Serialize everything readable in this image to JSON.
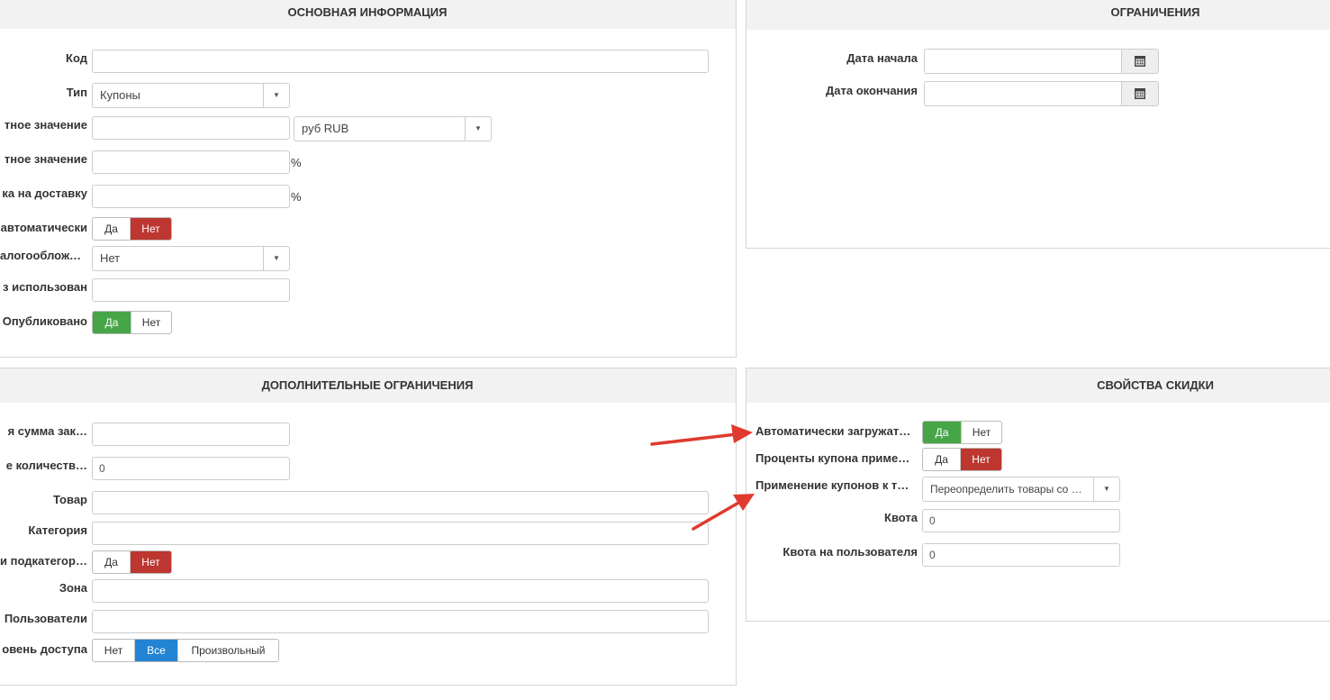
{
  "basic": {
    "title": "ОСНОВНАЯ ИНФОРМАЦИЯ",
    "code_label": "Код",
    "type_label": "Тип",
    "type_value": "Купоны",
    "fixed_label": "тное значение",
    "currency_value": "руб RUB",
    "percent_label": "тное значение",
    "shipping_label": "ка на доставку",
    "percent_sign": "%",
    "auto_label": "автоматически",
    "tax_label": "алогообложе…",
    "tax_value": "Нет",
    "uses_label": "з использован",
    "published_label": "Опубликовано",
    "yes": "Да",
    "no": "Нет"
  },
  "restrictions": {
    "title": "ОГРАНИЧЕНИЯ",
    "start_label": "Дата начала",
    "end_label": "Дата окончания"
  },
  "extra": {
    "title": "ДОПОЛНИТЕЛЬНЫЕ ОГРАНИЧЕНИЯ",
    "min_sum_label": "я сумма зак…",
    "min_qty_label": "е количеств…",
    "min_qty_value": "0",
    "product_label": "Товар",
    "category_label": "Категория",
    "subcat_label": "и подкатегории",
    "zone_label": "Зона",
    "users_label": "Пользователи",
    "access_label": "овень доступа",
    "access_options": [
      "Нет",
      "Все",
      "Произвольный"
    ]
  },
  "discount": {
    "title": "СВОЙСТВА СКИДКИ",
    "autoload_label": "Автоматически загружат…",
    "percent_apply_label": "Проценты купона приме…",
    "apply_label": "Применение купонов к т…",
    "apply_value": "Переопределить товары со …",
    "quota_label": "Квота",
    "quota_value": "0",
    "user_quota_label": "Квота на пользователя",
    "user_quota_value": "0"
  },
  "colors": {
    "red": "#bd362f",
    "green": "#46a546",
    "blue": "#2384d3",
    "annotation": "#e03a2f"
  }
}
